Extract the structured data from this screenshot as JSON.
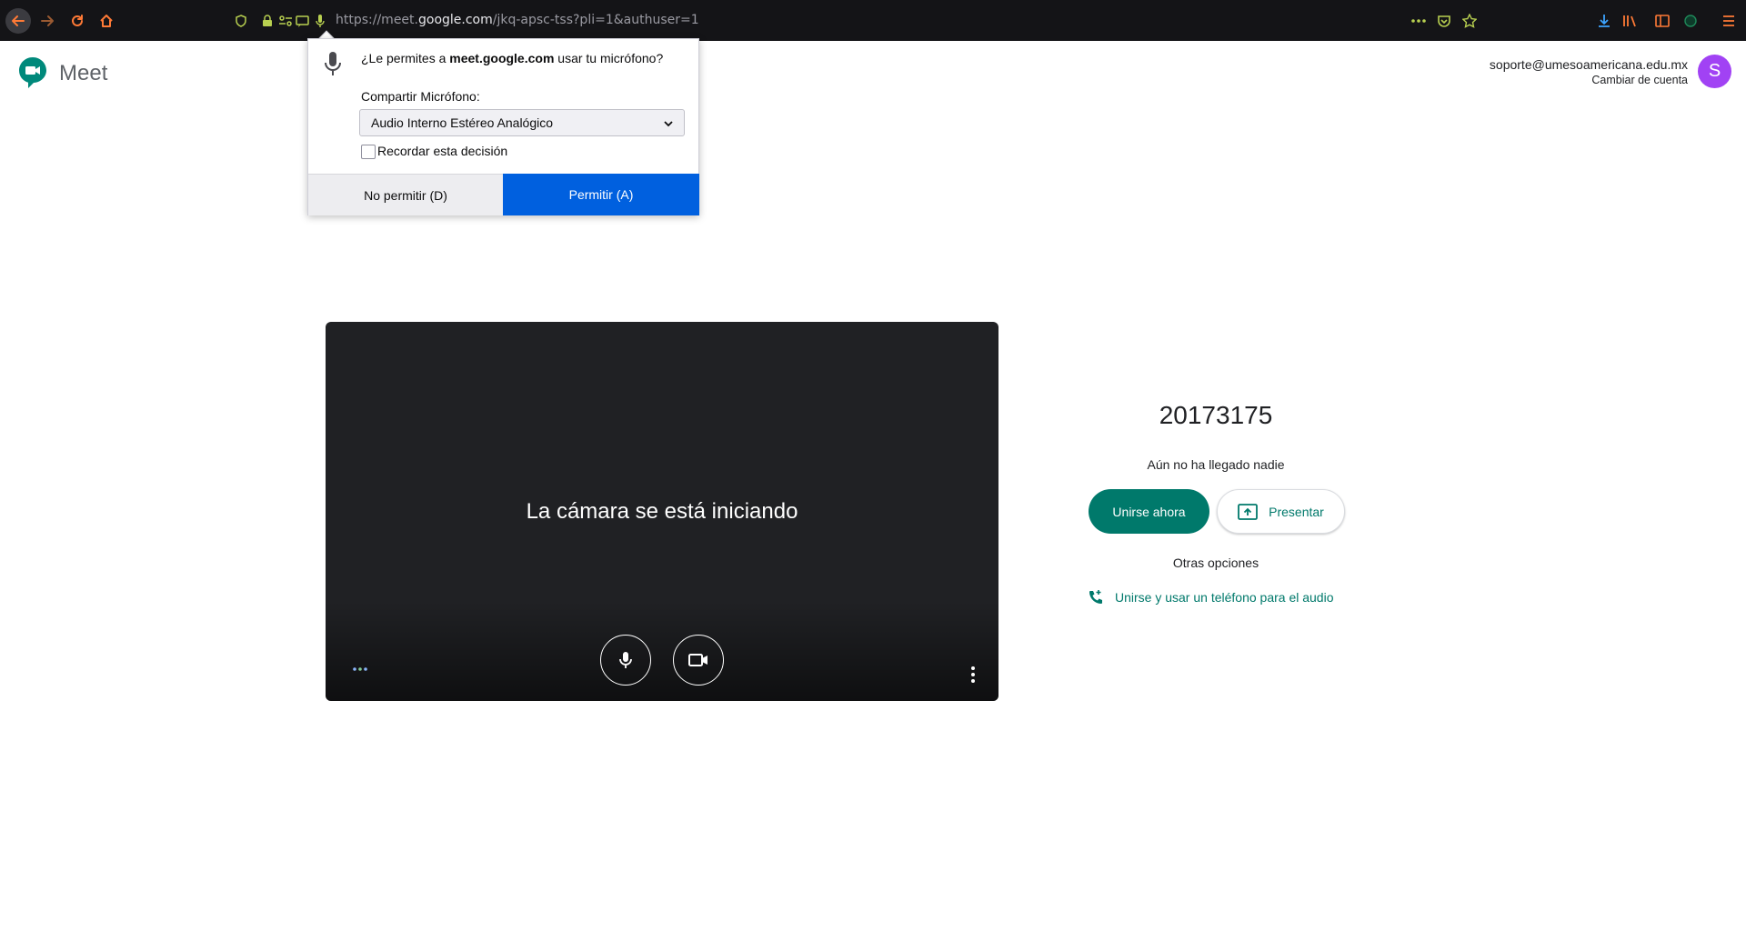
{
  "browser": {
    "url_prefix": "https://meet.",
    "url_host": "google.com",
    "url_path": "/jkq-apsc-tss?pli=1&authuser=1"
  },
  "meet": {
    "brand": "Meet",
    "account_email": "soporte@umesoamericana.edu.mx",
    "account_switch": "Cambiar de cuenta",
    "avatar_letter": "S",
    "accent_color": "#00796b",
    "avatar_color": "#a142f4"
  },
  "permission_popup": {
    "question_prefix": "¿Le permites a ",
    "question_host": "meet.google.com",
    "question_suffix": " usar tu micrófono?",
    "share_label": "Compartir Micrófono:",
    "selected_device": "Audio Interno Estéreo Analógico",
    "remember_label": "Recordar esta decisión",
    "deny_label": "No permitir (D)",
    "allow_label": "Permitir (A)",
    "allow_color": "#0060df"
  },
  "preview": {
    "status_text": "La cámara se está iniciando"
  },
  "join_panel": {
    "meeting_code": "20173175",
    "status": "Aún no ha llegado nadie",
    "join_label": "Unirse ahora",
    "present_label": "Presentar",
    "other_options": "Otras opciones",
    "phone_label": "Unirse y usar un teléfono para el audio"
  }
}
